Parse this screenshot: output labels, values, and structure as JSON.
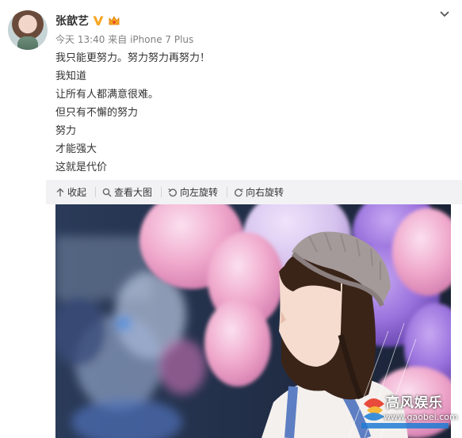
{
  "post": {
    "author": "张歆艺",
    "timestamp": "今天 13:40",
    "source_prefix": "来自",
    "source": "iPhone 7 Plus",
    "lines": [
      "我只能更努力。努力努力再努力！",
      "我知道",
      "让所有人都满意很难。",
      "但只有不懈的努力",
      "努力",
      "才能强大",
      "这就是代价"
    ]
  },
  "toolbar": {
    "collapse": "收起",
    "view_large": "查看大图",
    "rotate_left": "向左旋转",
    "rotate_right": "向右旋转"
  },
  "watermark": {
    "name": "高风娱乐",
    "url": "www.gaobei.com"
  },
  "icons": {
    "verified": "verified-v-icon",
    "member": "member-crown-icon",
    "expand": "chevron-down-icon",
    "collapse": "arrow-up-icon",
    "view": "magnifier-icon",
    "rotate_left": "rotate-left-icon",
    "rotate_right": "rotate-right-icon"
  },
  "colors": {
    "verified": "#f5a623",
    "text": "#333333",
    "meta": "#808080",
    "toolbar_bg": "#f2f2f5"
  }
}
